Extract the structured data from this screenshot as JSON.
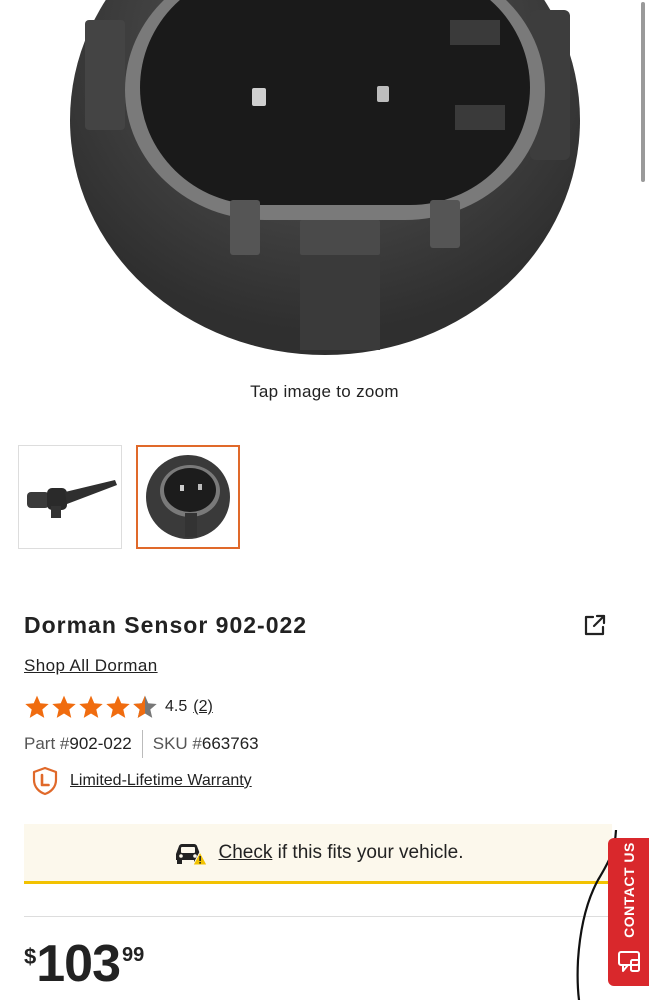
{
  "image": {
    "hint": "Tap image to zoom"
  },
  "thumbnails": [
    {
      "name": "thumbnail-sensor-side",
      "selected": false
    },
    {
      "name": "thumbnail-sensor-connector",
      "selected": true
    }
  ],
  "product": {
    "title": "Dorman Sensor 902-022",
    "shop_link": "Shop All Dorman",
    "rating": {
      "value": "4.5",
      "count": "(2)",
      "stars": 4.5
    },
    "part_label": "Part #",
    "part_value": "902-022",
    "sku_label": "SKU #",
    "sku_value": "663763",
    "warranty": "Limited-Lifetime Warranty"
  },
  "fitment": {
    "link": "Check",
    "text": " if this fits your vehicle."
  },
  "price": {
    "currency": "$",
    "dollars": "103",
    "cents": "99"
  },
  "contact": {
    "label": "CONTACT US"
  },
  "colors": {
    "accent": "#e0692a",
    "star": "#f06c0f",
    "contact": "#d9282c",
    "fit_border": "#f2c200"
  }
}
